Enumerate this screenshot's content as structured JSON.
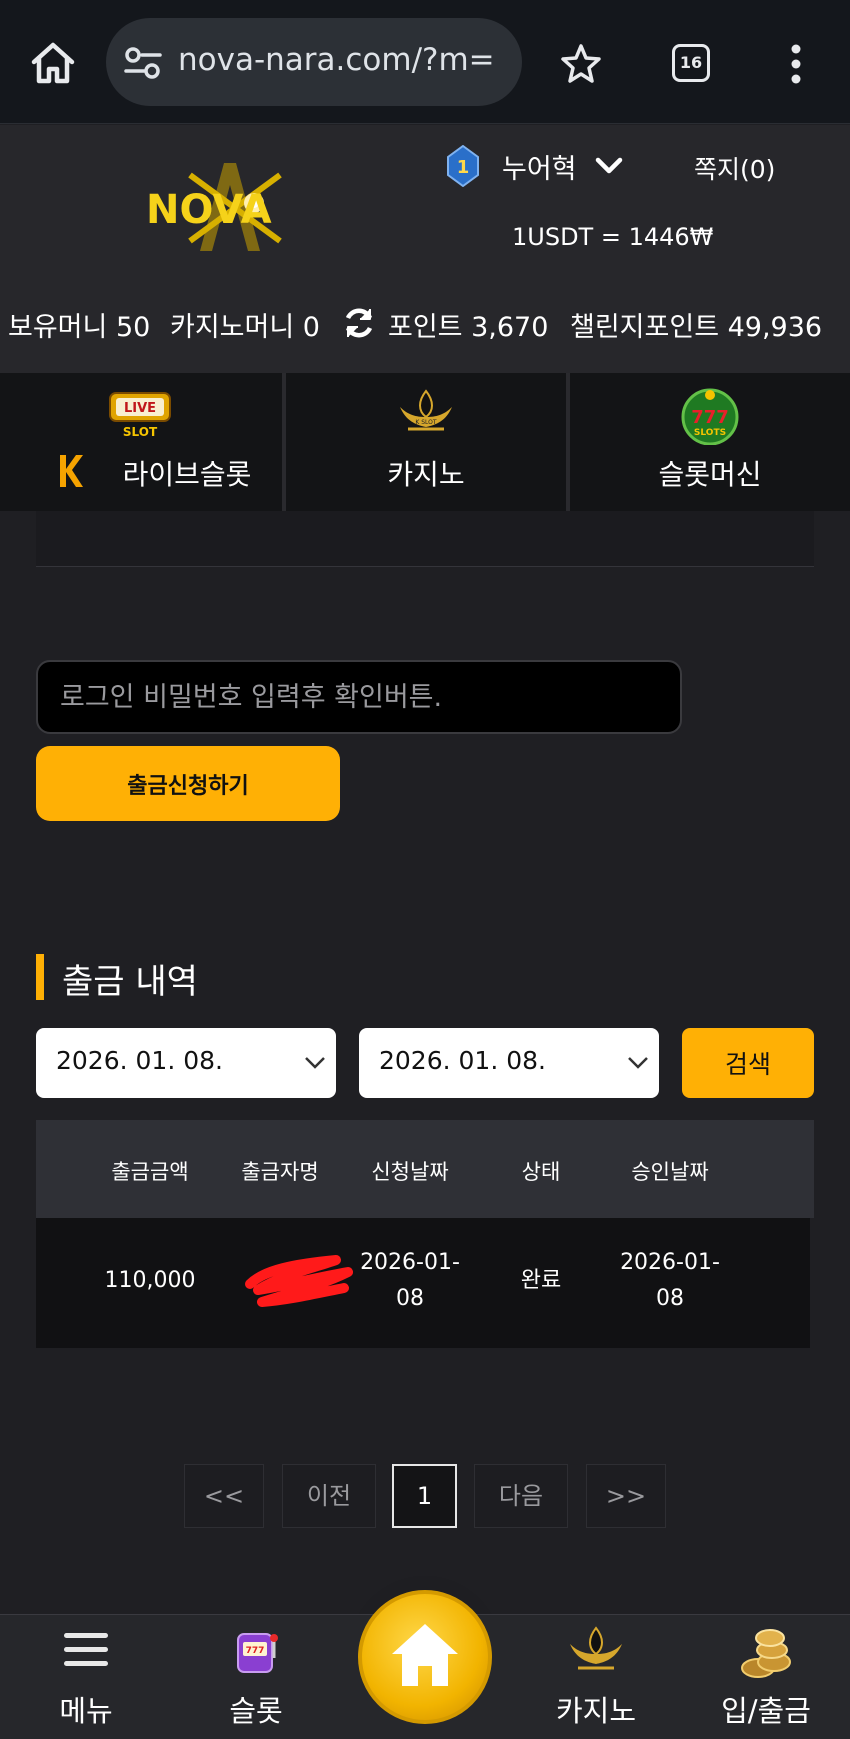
{
  "browser": {
    "url": "nova-nara.com/?m=",
    "tab_count": "16"
  },
  "header": {
    "logo_text": "NOVA",
    "level": "1",
    "username": "누어혁",
    "memo_label": "쪽지(0)",
    "exchange_rate": "1USDT = 1446₩",
    "balances": {
      "money_label": "보유머니 50",
      "casino_money_label": "카지노머니 0",
      "point_label": "포인트 3,670",
      "challenge_point_label": "챌린지포인트 49,936"
    }
  },
  "categories": [
    {
      "label": "라이브슬롯",
      "icon": "live-slot-icon",
      "icon_text": "LIVE SLOT"
    },
    {
      "label": "카지노",
      "icon": "k-slot-icon",
      "icon_text": "K SLOT"
    },
    {
      "label": "슬롯머신",
      "icon": "777-slots-icon",
      "icon_text": "777 SLOTS"
    }
  ],
  "withdraw_form": {
    "password_placeholder": "로그인 비밀번호 입력후 확인버튼.",
    "submit_label": "출금신청하기"
  },
  "history": {
    "title": "출금 내역",
    "date_from": "2026. 01. 08.",
    "date_to": "2026. 01. 08.",
    "search_label": "검색",
    "columns": [
      "출금금액",
      "출금자명",
      "신청날짜",
      "상태",
      "승인날짜"
    ],
    "rows": [
      {
        "amount": "110,000",
        "name": "",
        "request_date_1": "2026-01-",
        "request_date_2": "08",
        "status": "완료",
        "approve_date_1": "2026-01-",
        "approve_date_2": "08"
      }
    ]
  },
  "pagination": {
    "first": "<<",
    "prev": "이전",
    "current": "1",
    "next": "다음",
    "last": ">>"
  },
  "bottom_nav": {
    "menu": "메뉴",
    "slot": "슬롯",
    "casino": "카지노",
    "deposit": "입/출금"
  },
  "colors": {
    "accent": "#ffb005",
    "background": "#1f1f23"
  }
}
